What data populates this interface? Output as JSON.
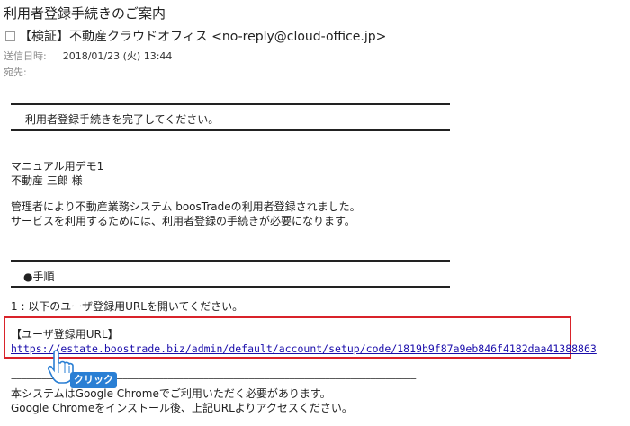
{
  "email": {
    "subject": "利用者登録手続きのご案内",
    "from": "【検証】不動産クラウドオフィス <no-reply@cloud-office.jp>",
    "sent_label": "送信日時:",
    "sent_value": "2018/01/23 (火) 13:44",
    "to_label": "宛先:"
  },
  "body": {
    "banner_title": "利用者登録手続きを完了してください。",
    "recipient_company": "マニュアル用デモ1",
    "recipient_name": "不動産 三郎 様",
    "intro_1": "管理者により不動産業務システム boosTradeの利用者登録されました。",
    "intro_2": "サービスを利用するためには、利用者登録の手続きが必要になります。",
    "steps_title": "●手順",
    "step_1": "1 : 以下のユーザ登録用URLを開いてください。",
    "url_label": "【ユーザ登録用URL】",
    "url": "https://estate.boostrade.biz/admin/default/account/setup/code/1819b9f87a9eb846f4182daa41388863",
    "dashes": "================================================================================",
    "note_1": "本システムはGoogle Chromeでご利用いただく必要があります。",
    "note_2": "Google Chromeをインストール後、上記URLよりアクセスください。"
  },
  "overlay": {
    "click_label": "クリック"
  },
  "colors": {
    "highlight_border": "#d9232a",
    "link": "#1a0dab",
    "badge": "#2a7fd4"
  }
}
